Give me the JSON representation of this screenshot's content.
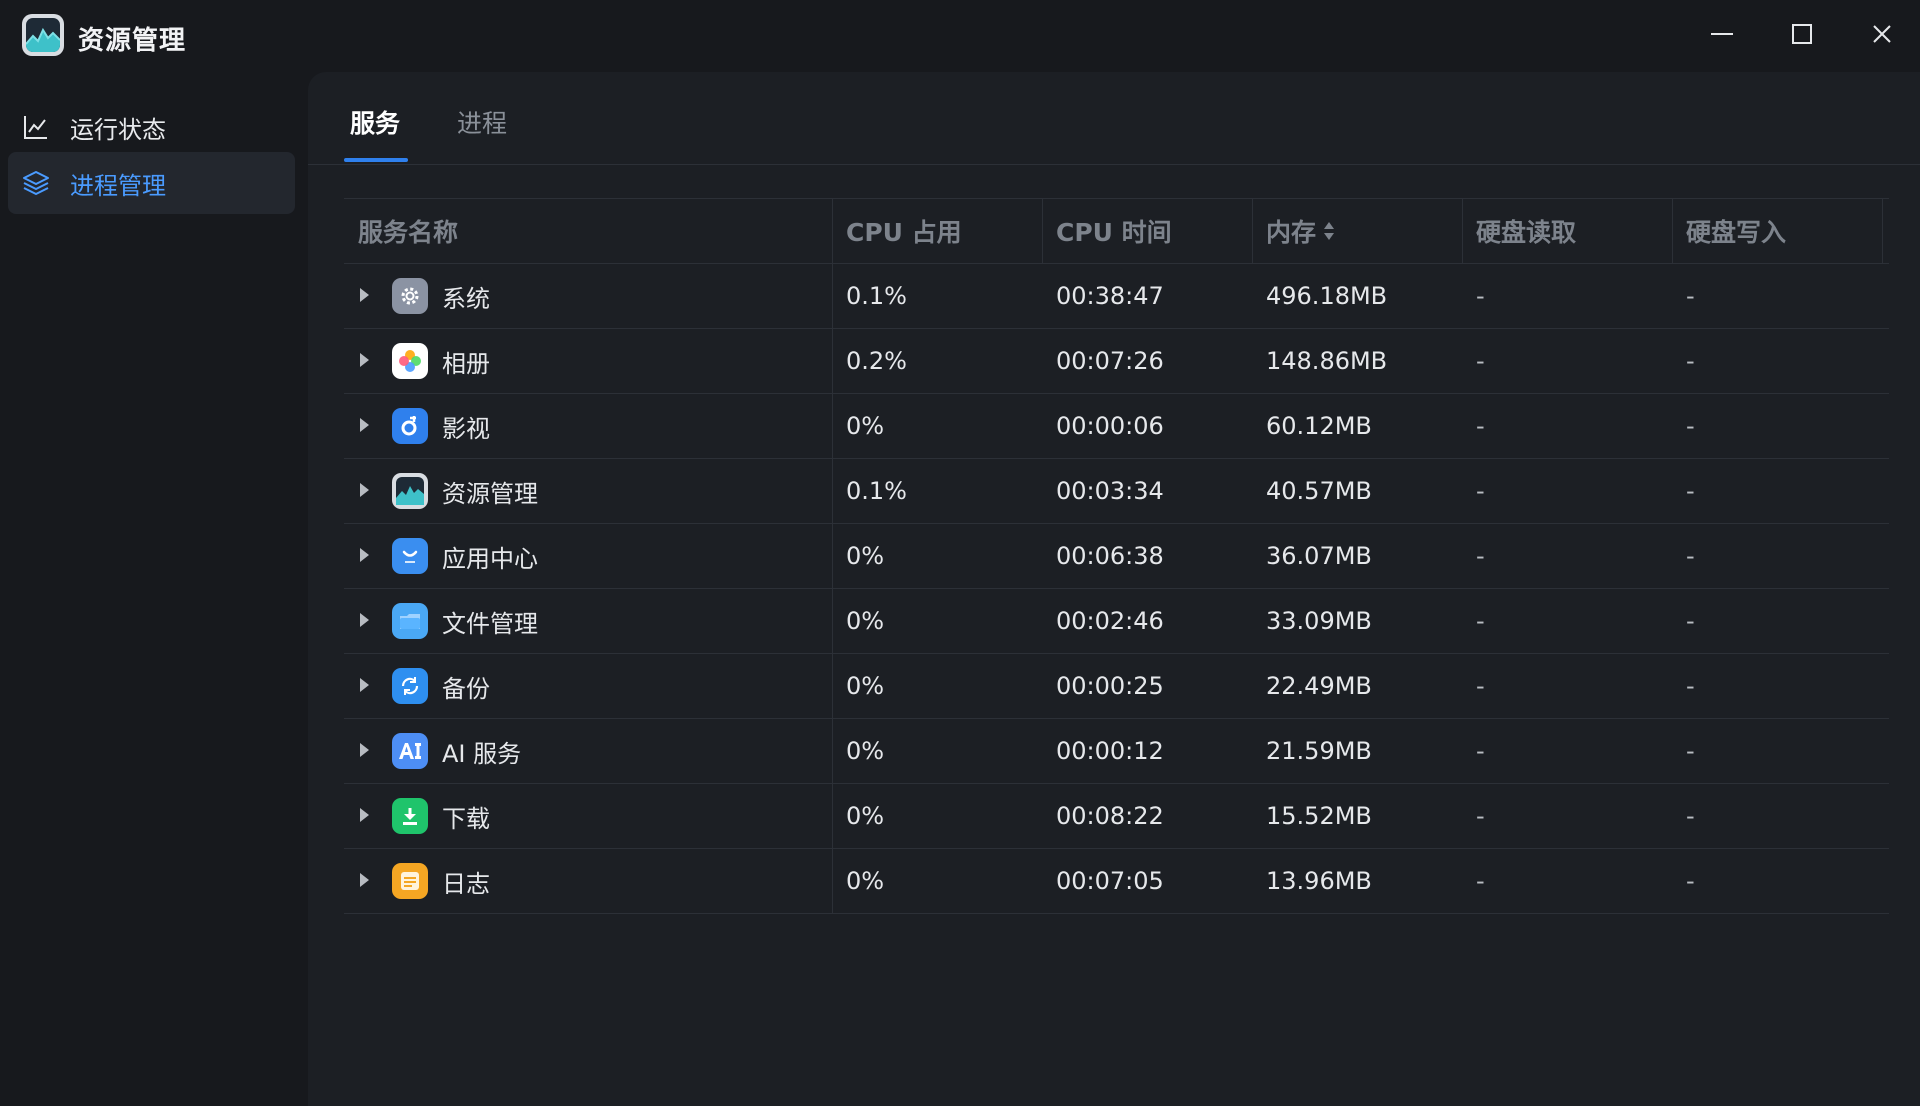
{
  "window": {
    "title": "资源管理"
  },
  "sidebar": {
    "items": [
      {
        "label": "运行状态",
        "icon": "line-chart-icon",
        "active": false
      },
      {
        "label": "进程管理",
        "icon": "layers-icon",
        "active": true
      }
    ]
  },
  "tabs": [
    {
      "label": "服务",
      "active": true
    },
    {
      "label": "进程",
      "active": false
    }
  ],
  "table": {
    "columns": [
      "服务名称",
      "CPU 占用",
      "CPU 时间",
      "内存",
      "硬盘读取",
      "硬盘写入"
    ],
    "sorted_column": "内存",
    "rows": [
      {
        "name": "系统",
        "icon": "settings-gear-icon",
        "cpu": "0.1%",
        "cpu_time": "00:38:47",
        "memory": "496.18MB",
        "disk_read": "-",
        "disk_write": "-"
      },
      {
        "name": "相册",
        "icon": "photos-flower-icon",
        "cpu": "0.2%",
        "cpu_time": "00:07:26",
        "memory": "148.86MB",
        "disk_read": "-",
        "disk_write": "-"
      },
      {
        "name": "影视",
        "icon": "video-icon",
        "cpu": "0%",
        "cpu_time": "00:00:06",
        "memory": "60.12MB",
        "disk_read": "-",
        "disk_write": "-"
      },
      {
        "name": "资源管理",
        "icon": "resource-monitor-icon",
        "cpu": "0.1%",
        "cpu_time": "00:03:34",
        "memory": "40.57MB",
        "disk_read": "-",
        "disk_write": "-"
      },
      {
        "name": "应用中心",
        "icon": "store-bag-icon",
        "cpu": "0%",
        "cpu_time": "00:06:38",
        "memory": "36.07MB",
        "disk_read": "-",
        "disk_write": "-"
      },
      {
        "name": "文件管理",
        "icon": "folder-icon",
        "cpu": "0%",
        "cpu_time": "00:02:46",
        "memory": "33.09MB",
        "disk_read": "-",
        "disk_write": "-"
      },
      {
        "name": "备份",
        "icon": "backup-sync-icon",
        "cpu": "0%",
        "cpu_time": "00:00:25",
        "memory": "22.49MB",
        "disk_read": "-",
        "disk_write": "-"
      },
      {
        "name": "AI 服务",
        "icon": "ai-icon",
        "cpu": "0%",
        "cpu_time": "00:00:12",
        "memory": "21.59MB",
        "disk_read": "-",
        "disk_write": "-"
      },
      {
        "name": "下载",
        "icon": "download-icon",
        "cpu": "0%",
        "cpu_time": "00:08:22",
        "memory": "15.52MB",
        "disk_read": "-",
        "disk_write": "-"
      },
      {
        "name": "日志",
        "icon": "log-list-icon",
        "cpu": "0%",
        "cpu_time": "00:07:05",
        "memory": "13.96MB",
        "disk_read": "-",
        "disk_write": "-"
      }
    ]
  },
  "colors": {
    "accent": "#2f80ed",
    "background": "#17191d",
    "panel": "#1c1f24"
  }
}
